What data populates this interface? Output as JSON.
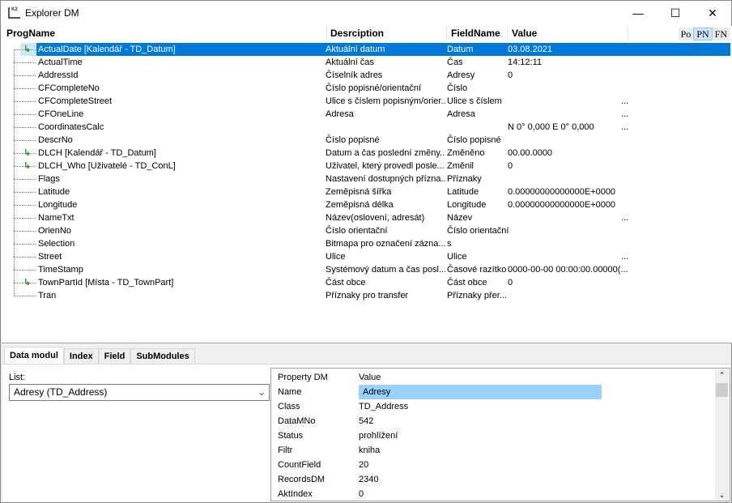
{
  "window": {
    "title": "Explorer DM",
    "minimize": "—",
    "maximize": "☐",
    "close": "✕"
  },
  "grid": {
    "headers": {
      "progname": "ProgName",
      "description": "Desrciption",
      "fieldname": "FieldName",
      "value": "Value"
    },
    "mode_buttons": [
      "Po",
      "PN",
      "FN"
    ],
    "active_mode": "PN",
    "rows": [
      {
        "prog": "ActualDate [Kalendář - TD_Datum]",
        "desc": "Aktuální datum",
        "field": "Datum",
        "value": "03.08.2021",
        "more": "",
        "link": true,
        "selected": true
      },
      {
        "prog": "ActualTime",
        "desc": "Aktuální čas",
        "field": "Čas",
        "value": "14:12:11",
        "more": ""
      },
      {
        "prog": "AddressId",
        "desc": "Číselník adres",
        "field": "Adresy",
        "value": "0",
        "more": ""
      },
      {
        "prog": "CFCompleteNo",
        "desc": "Číslo popisné/orientační",
        "field": "Číslo",
        "value": "",
        "more": ""
      },
      {
        "prog": "CFCompleteStreet",
        "desc": "Ulice s číslem popisným/orier...",
        "field": "Ulice s číslem",
        "value": "",
        "more": "..."
      },
      {
        "prog": "CFOneLine",
        "desc": "Adresa",
        "field": "Adresa",
        "value": "",
        "more": "..."
      },
      {
        "prog": "CoordinatesCalc",
        "desc": "",
        "field": "",
        "value": "N 0° 0,000 E 0° 0,000",
        "more": "..."
      },
      {
        "prog": "DescrNo",
        "desc": "Číslo popisné",
        "field": "Číslo popisné",
        "value": "",
        "more": ""
      },
      {
        "prog": "DLCH [Kalendář - TD_Datum]",
        "desc": "Datum a čas poslední změny...",
        "field": "Změněno",
        "value": "00.00.0000",
        "more": "",
        "link": true
      },
      {
        "prog": "DLCH_Who [Uživatelé - TD_ConL]",
        "desc": "Uživatel, který provedl posle...",
        "field": "Změnil",
        "value": "0",
        "more": "",
        "link": true
      },
      {
        "prog": "Flags",
        "desc": "Nastavení dostupných přízna...",
        "field": "Příznaky",
        "value": "",
        "more": ""
      },
      {
        "prog": "Latitude",
        "desc": "Zeměpisná šířka",
        "field": "Latitude",
        "value": " 0.00000000000000E+0000",
        "more": ""
      },
      {
        "prog": "Longitude",
        "desc": "Zeměpisná délka",
        "field": "Longitude",
        "value": " 0.00000000000000E+0000",
        "more": ""
      },
      {
        "prog": "NameTxt",
        "desc": "Název(oslovení, adresát)",
        "field": "Název",
        "value": "",
        "more": "..."
      },
      {
        "prog": "OrienNo",
        "desc": "Číslo orientační",
        "field": "Číslo orientační",
        "value": "",
        "more": ""
      },
      {
        "prog": "Selection",
        "desc": "Bitmapa pro označení zázna...",
        "field": "s",
        "value": "",
        "more": ""
      },
      {
        "prog": "Street",
        "desc": "Ulice",
        "field": "Ulice",
        "value": "",
        "more": "..."
      },
      {
        "prog": "TimeStamp",
        "desc": "Systémový datum a čas posl...",
        "field": "Časové razítko",
        "value": "0000-00-00 00:00:00.00000(...",
        "more": ""
      },
      {
        "prog": "TownPartId [Místa - TD_TownPart]",
        "desc": "Část obce",
        "field": "Část obce",
        "value": "0",
        "more": "",
        "link": true
      },
      {
        "prog": "Tran",
        "desc": "Příznaky pro transfer",
        "field": "Příznaky přer...",
        "value": "",
        "more": ""
      }
    ]
  },
  "tabs": [
    {
      "label": "Data modul",
      "active": true
    },
    {
      "label": "Index"
    },
    {
      "label": "Field"
    },
    {
      "label": "SubModules"
    }
  ],
  "list": {
    "label": "List:",
    "value": "Adresy (TD_Address)"
  },
  "properties": {
    "headers": {
      "property": "Property DM",
      "value": "Value"
    },
    "rows": [
      {
        "name": "Name",
        "value": "Adresy",
        "selected": true
      },
      {
        "name": "Class",
        "value": "TD_Address"
      },
      {
        "name": "DataMNo",
        "value": "542"
      },
      {
        "name": "Status",
        "value": "prohlížení"
      },
      {
        "name": "Filtr",
        "value": "kniha"
      },
      {
        "name": "CountField",
        "value": "20"
      },
      {
        "name": "RecordsDM",
        "value": "2340"
      },
      {
        "name": "AktIndex",
        "value": "0"
      }
    ]
  },
  "colors": {
    "selection": "#0078d7",
    "property_selection": "#99d1ff",
    "link_arrow": "#2a8a2a"
  }
}
